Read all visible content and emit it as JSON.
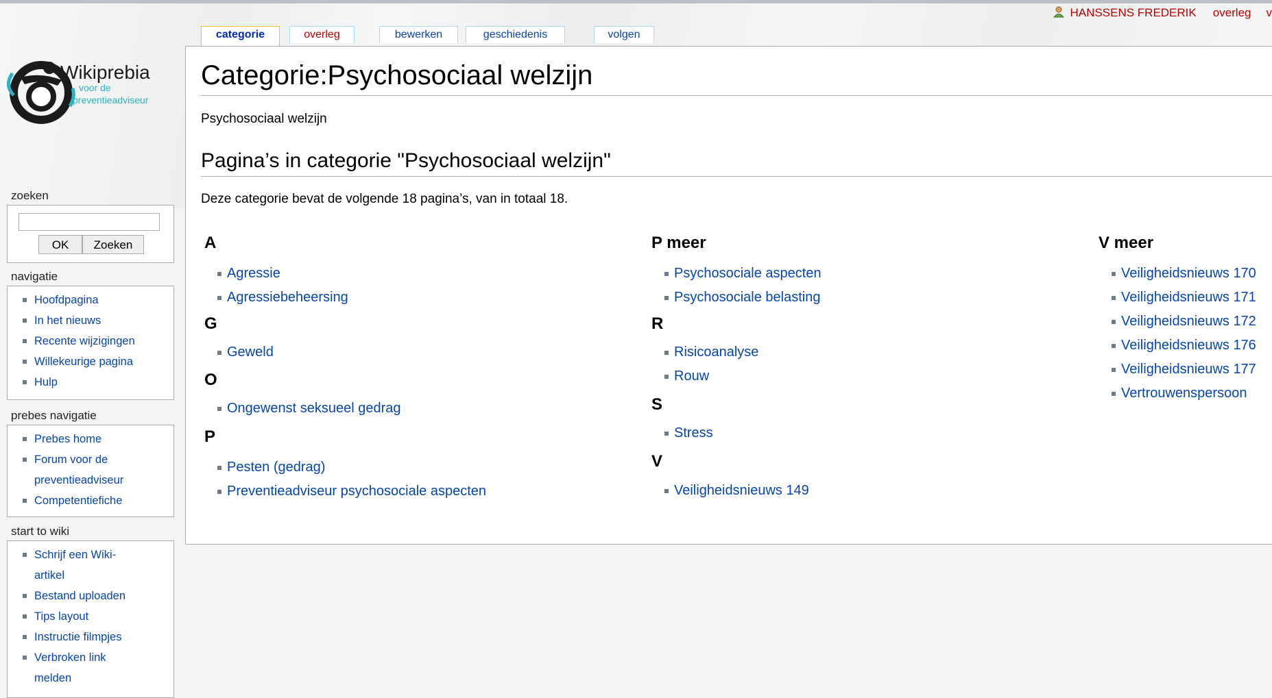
{
  "personal": {
    "username": "HANSSENS FREDERIK",
    "talk": "overleg",
    "more": "v"
  },
  "tabs": [
    {
      "label": "categorie",
      "selected": true
    },
    {
      "label": "overleg",
      "new": true
    },
    {
      "label": "bewerken"
    },
    {
      "label": "geschiedenis"
    },
    {
      "label": "volgen"
    }
  ],
  "logo": {
    "title": "Wikiprebia",
    "subtitle1": "voor de",
    "subtitle2": "preventieadviseur"
  },
  "search": {
    "heading": "zoeken",
    "ok_label": "OK",
    "zoeken_label": "Zoeken",
    "value": ""
  },
  "navigation": {
    "heading": "navigatie",
    "items": [
      "Hoofdpagina",
      "In het nieuws",
      "Recente wijzigingen",
      "Willekeurige pagina",
      "Hulp"
    ]
  },
  "prebes": {
    "heading": "prebes navigatie",
    "items": [
      "Prebes home",
      "Forum voor de preventieadviseur",
      "Competentiefiche"
    ]
  },
  "start": {
    "heading": "start to wiki",
    "items": [
      "Schrijf een Wiki-artikel",
      "Bestand uploaden",
      "Tips layout",
      "Instructie filmpjes",
      "Verbroken link melden"
    ]
  },
  "page": {
    "title": "Categorie:Psychosociaal welzijn",
    "description": "Psychosociaal welzijn",
    "subheading": "Pagina’s in categorie \"Psychosociaal welzijn\"",
    "count_text": "Deze categorie bevat de volgende 18 pagina’s, van in totaal 18."
  },
  "columns": [
    {
      "groups": [
        {
          "letter": "A",
          "items": [
            "Agressie",
            "Agressiebeheersing"
          ]
        },
        {
          "letter": "G",
          "items": [
            "Geweld"
          ]
        },
        {
          "letter": "O",
          "items": [
            "Ongewenst seksueel gedrag"
          ]
        },
        {
          "letter": "P",
          "items": [
            "Pesten (gedrag)",
            "Preventieadviseur psychosociale aspecten"
          ]
        }
      ]
    },
    {
      "groups": [
        {
          "letter": "P meer",
          "items": [
            "Psychosociale aspecten",
            "Psychosociale belasting"
          ]
        },
        {
          "letter": "R",
          "items": [
            "Risicoanalyse",
            "Rouw"
          ]
        },
        {
          "letter": "S",
          "items": [
            "Stress"
          ]
        },
        {
          "letter": "V",
          "items": [
            "Veiligheidsnieuws 149"
          ]
        }
      ]
    },
    {
      "groups": [
        {
          "letter": "V meer",
          "items": [
            "Veiligheidsnieuws 170",
            "Veiligheidsnieuws 171",
            "Veiligheidsnieuws 172",
            "Veiligheidsnieuws 176",
            "Veiligheidsnieuws 177",
            "Vertrouwenspersoon"
          ]
        }
      ]
    }
  ]
}
